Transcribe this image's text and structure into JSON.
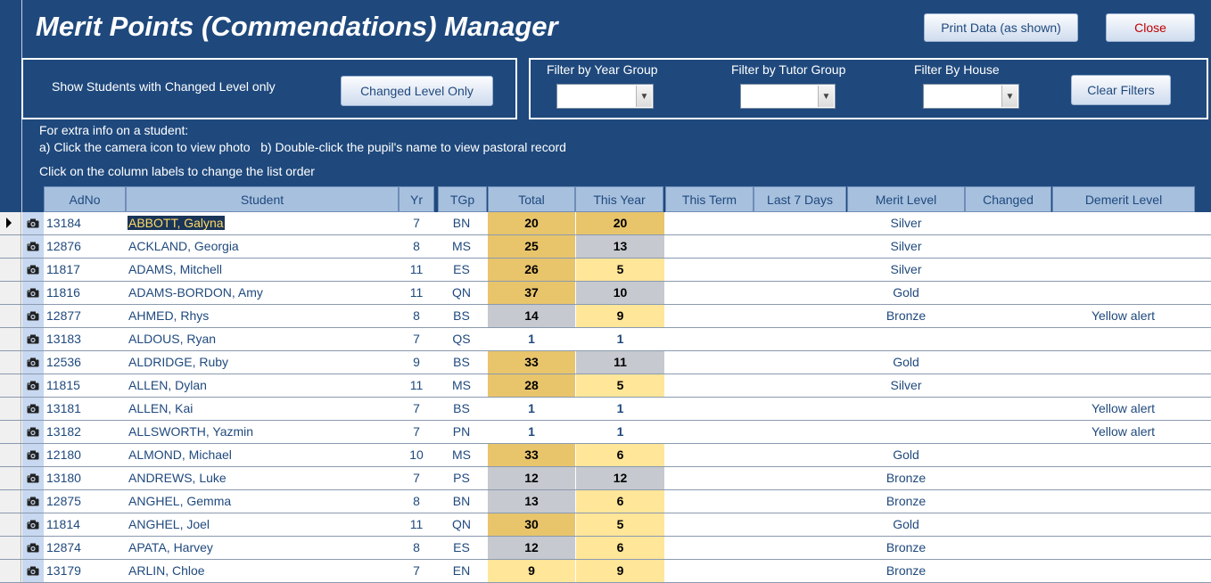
{
  "app": {
    "title": "Merit Points (Commendations) Manager",
    "print_label": "Print Data (as shown)",
    "close_label": "Close"
  },
  "changed_panel": {
    "label": "Show Students with Changed Level only",
    "button": "Changed Level Only"
  },
  "filters": {
    "year_label": "Filter by Year Group",
    "tutor_label": "Filter by Tutor Group",
    "house_label": "Filter By House",
    "year_value": "",
    "tutor_value": "",
    "house_value": "",
    "clear_label": "Clear Filters"
  },
  "instructions": {
    "line1": "For extra info on a student:",
    "line2": "a) Click the camera icon to view photo   b) Double-click the pupil's name to view pastoral record",
    "line3": "Click on the column labels to change the list order"
  },
  "columns": [
    "AdNo",
    "Student",
    "Yr",
    "TGp",
    "Total",
    "This Year",
    "This Term",
    "Last 7 Days",
    "Merit Level",
    "Changed",
    "Demerit Level"
  ],
  "rows": [
    {
      "adno": "13184",
      "name": "ABBOTT, Galyna",
      "yr": "7",
      "tgp": "BN",
      "total": "20",
      "total_bg": "gold",
      "year": "20",
      "year_bg": "gold",
      "merit": "Silver",
      "demerit": "",
      "selected": true
    },
    {
      "adno": "12876",
      "name": "ACKLAND, Georgia",
      "yr": "8",
      "tgp": "MS",
      "total": "25",
      "total_bg": "gold",
      "year": "13",
      "year_bg": "grey",
      "merit": "Silver",
      "demerit": ""
    },
    {
      "adno": "11817",
      "name": "ADAMS, Mitchell",
      "yr": "11",
      "tgp": "ES",
      "total": "26",
      "total_bg": "gold",
      "year": "5",
      "year_bg": "light",
      "merit": "Silver",
      "demerit": ""
    },
    {
      "adno": "11816",
      "name": "ADAMS-BORDON, Amy",
      "yr": "11",
      "tgp": "QN",
      "total": "37",
      "total_bg": "gold",
      "year": "10",
      "year_bg": "grey",
      "merit": "Gold",
      "demerit": ""
    },
    {
      "adno": "12877",
      "name": "AHMED, Rhys",
      "yr": "8",
      "tgp": "BS",
      "total": "14",
      "total_bg": "grey",
      "year": "9",
      "year_bg": "light",
      "merit": "Bronze",
      "demerit": "Yellow alert"
    },
    {
      "adno": "13183",
      "name": "ALDOUS, Ryan",
      "yr": "7",
      "tgp": "QS",
      "total": "1",
      "total_bg": "none",
      "year": "1",
      "year_bg": "none",
      "merit": "",
      "demerit": ""
    },
    {
      "adno": "12536",
      "name": "ALDRIDGE, Ruby",
      "yr": "9",
      "tgp": "BS",
      "total": "33",
      "total_bg": "gold",
      "year": "11",
      "year_bg": "grey",
      "merit": "Gold",
      "demerit": ""
    },
    {
      "adno": "11815",
      "name": "ALLEN, Dylan",
      "yr": "11",
      "tgp": "MS",
      "total": "28",
      "total_bg": "gold",
      "year": "5",
      "year_bg": "light",
      "merit": "Silver",
      "demerit": ""
    },
    {
      "adno": "13181",
      "name": "ALLEN, Kai",
      "yr": "7",
      "tgp": "BS",
      "total": "1",
      "total_bg": "none",
      "year": "1",
      "year_bg": "none",
      "merit": "",
      "demerit": "Yellow alert"
    },
    {
      "adno": "13182",
      "name": "ALLSWORTH, Yazmin",
      "yr": "7",
      "tgp": "PN",
      "total": "1",
      "total_bg": "none",
      "year": "1",
      "year_bg": "none",
      "merit": "",
      "demerit": "Yellow alert"
    },
    {
      "adno": "12180",
      "name": "ALMOND, Michael",
      "yr": "10",
      "tgp": "MS",
      "total": "33",
      "total_bg": "gold",
      "year": "6",
      "year_bg": "light",
      "merit": "Gold",
      "demerit": ""
    },
    {
      "adno": "13180",
      "name": "ANDREWS, Luke",
      "yr": "7",
      "tgp": "PS",
      "total": "12",
      "total_bg": "grey",
      "year": "12",
      "year_bg": "grey",
      "merit": "Bronze",
      "demerit": ""
    },
    {
      "adno": "12875",
      "name": "ANGHEL, Gemma",
      "yr": "8",
      "tgp": "BN",
      "total": "13",
      "total_bg": "grey",
      "year": "6",
      "year_bg": "light",
      "merit": "Bronze",
      "demerit": ""
    },
    {
      "adno": "11814",
      "name": "ANGHEL, Joel",
      "yr": "11",
      "tgp": "QN",
      "total": "30",
      "total_bg": "gold",
      "year": "5",
      "year_bg": "light",
      "merit": "Gold",
      "demerit": ""
    },
    {
      "adno": "12874",
      "name": "APATA, Harvey",
      "yr": "8",
      "tgp": "ES",
      "total": "12",
      "total_bg": "grey",
      "year": "6",
      "year_bg": "light",
      "merit": "Bronze",
      "demerit": ""
    },
    {
      "adno": "13179",
      "name": "ARLIN, Chloe",
      "yr": "7",
      "tgp": "EN",
      "total": "9",
      "total_bg": "light",
      "year": "9",
      "year_bg": "light",
      "merit": "Bronze",
      "demerit": ""
    }
  ]
}
